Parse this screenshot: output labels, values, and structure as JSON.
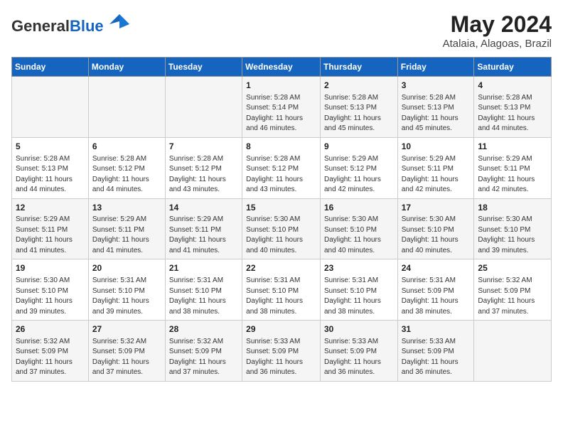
{
  "header": {
    "logo_general": "General",
    "logo_blue": "Blue",
    "month": "May 2024",
    "location": "Atalaia, Alagoas, Brazil"
  },
  "days_of_week": [
    "Sunday",
    "Monday",
    "Tuesday",
    "Wednesday",
    "Thursday",
    "Friday",
    "Saturday"
  ],
  "weeks": [
    [
      {
        "day": "",
        "info": ""
      },
      {
        "day": "",
        "info": ""
      },
      {
        "day": "",
        "info": ""
      },
      {
        "day": "1",
        "info": "Sunrise: 5:28 AM\nSunset: 5:14 PM\nDaylight: 11 hours and 46 minutes."
      },
      {
        "day": "2",
        "info": "Sunrise: 5:28 AM\nSunset: 5:13 PM\nDaylight: 11 hours and 45 minutes."
      },
      {
        "day": "3",
        "info": "Sunrise: 5:28 AM\nSunset: 5:13 PM\nDaylight: 11 hours and 45 minutes."
      },
      {
        "day": "4",
        "info": "Sunrise: 5:28 AM\nSunset: 5:13 PM\nDaylight: 11 hours and 44 minutes."
      }
    ],
    [
      {
        "day": "5",
        "info": "Sunrise: 5:28 AM\nSunset: 5:13 PM\nDaylight: 11 hours and 44 minutes."
      },
      {
        "day": "6",
        "info": "Sunrise: 5:28 AM\nSunset: 5:12 PM\nDaylight: 11 hours and 44 minutes."
      },
      {
        "day": "7",
        "info": "Sunrise: 5:28 AM\nSunset: 5:12 PM\nDaylight: 11 hours and 43 minutes."
      },
      {
        "day": "8",
        "info": "Sunrise: 5:28 AM\nSunset: 5:12 PM\nDaylight: 11 hours and 43 minutes."
      },
      {
        "day": "9",
        "info": "Sunrise: 5:29 AM\nSunset: 5:12 PM\nDaylight: 11 hours and 42 minutes."
      },
      {
        "day": "10",
        "info": "Sunrise: 5:29 AM\nSunset: 5:11 PM\nDaylight: 11 hours and 42 minutes."
      },
      {
        "day": "11",
        "info": "Sunrise: 5:29 AM\nSunset: 5:11 PM\nDaylight: 11 hours and 42 minutes."
      }
    ],
    [
      {
        "day": "12",
        "info": "Sunrise: 5:29 AM\nSunset: 5:11 PM\nDaylight: 11 hours and 41 minutes."
      },
      {
        "day": "13",
        "info": "Sunrise: 5:29 AM\nSunset: 5:11 PM\nDaylight: 11 hours and 41 minutes."
      },
      {
        "day": "14",
        "info": "Sunrise: 5:29 AM\nSunset: 5:11 PM\nDaylight: 11 hours and 41 minutes."
      },
      {
        "day": "15",
        "info": "Sunrise: 5:30 AM\nSunset: 5:10 PM\nDaylight: 11 hours and 40 minutes."
      },
      {
        "day": "16",
        "info": "Sunrise: 5:30 AM\nSunset: 5:10 PM\nDaylight: 11 hours and 40 minutes."
      },
      {
        "day": "17",
        "info": "Sunrise: 5:30 AM\nSunset: 5:10 PM\nDaylight: 11 hours and 40 minutes."
      },
      {
        "day": "18",
        "info": "Sunrise: 5:30 AM\nSunset: 5:10 PM\nDaylight: 11 hours and 39 minutes."
      }
    ],
    [
      {
        "day": "19",
        "info": "Sunrise: 5:30 AM\nSunset: 5:10 PM\nDaylight: 11 hours and 39 minutes."
      },
      {
        "day": "20",
        "info": "Sunrise: 5:31 AM\nSunset: 5:10 PM\nDaylight: 11 hours and 39 minutes."
      },
      {
        "day": "21",
        "info": "Sunrise: 5:31 AM\nSunset: 5:10 PM\nDaylight: 11 hours and 38 minutes."
      },
      {
        "day": "22",
        "info": "Sunrise: 5:31 AM\nSunset: 5:10 PM\nDaylight: 11 hours and 38 minutes."
      },
      {
        "day": "23",
        "info": "Sunrise: 5:31 AM\nSunset: 5:10 PM\nDaylight: 11 hours and 38 minutes."
      },
      {
        "day": "24",
        "info": "Sunrise: 5:31 AM\nSunset: 5:09 PM\nDaylight: 11 hours and 38 minutes."
      },
      {
        "day": "25",
        "info": "Sunrise: 5:32 AM\nSunset: 5:09 PM\nDaylight: 11 hours and 37 minutes."
      }
    ],
    [
      {
        "day": "26",
        "info": "Sunrise: 5:32 AM\nSunset: 5:09 PM\nDaylight: 11 hours and 37 minutes."
      },
      {
        "day": "27",
        "info": "Sunrise: 5:32 AM\nSunset: 5:09 PM\nDaylight: 11 hours and 37 minutes."
      },
      {
        "day": "28",
        "info": "Sunrise: 5:32 AM\nSunset: 5:09 PM\nDaylight: 11 hours and 37 minutes."
      },
      {
        "day": "29",
        "info": "Sunrise: 5:33 AM\nSunset: 5:09 PM\nDaylight: 11 hours and 36 minutes."
      },
      {
        "day": "30",
        "info": "Sunrise: 5:33 AM\nSunset: 5:09 PM\nDaylight: 11 hours and 36 minutes."
      },
      {
        "day": "31",
        "info": "Sunrise: 5:33 AM\nSunset: 5:09 PM\nDaylight: 11 hours and 36 minutes."
      },
      {
        "day": "",
        "info": ""
      }
    ]
  ]
}
